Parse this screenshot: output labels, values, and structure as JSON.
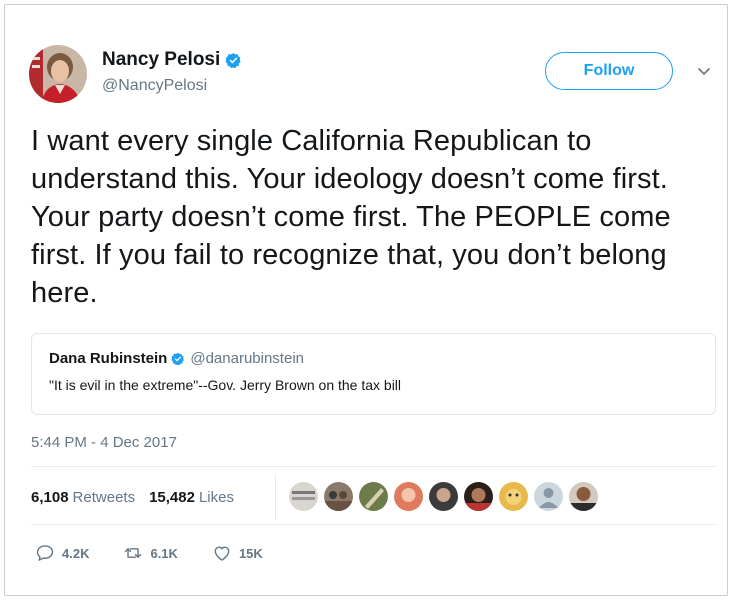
{
  "author": {
    "name": "Nancy Pelosi",
    "handle": "@NancyPelosi"
  },
  "follow_label": "Follow",
  "tweet_text": "I want every single California Republican to understand this. Your ideology doesn’t come first. Your party doesn’t come first. The PEOPLE come first. If you fail to recognize that, you don’t belong here.",
  "quoted": {
    "name": "Dana Rubinstein",
    "handle": "@danarubinstein",
    "text": "\"It is evil in the extreme\"--Gov. Jerry Brown on the tax bill"
  },
  "timestamp": "5:44 PM - 4 Dec 2017",
  "stats": {
    "retweets_count": "6,108",
    "retweets_label": "Retweets",
    "likes_count": "15,482",
    "likes_label": "Likes"
  },
  "actions": {
    "replies": "4.2K",
    "retweets": "6.1K",
    "likes": "15K"
  },
  "colors": {
    "accent": "#1da1f2",
    "muted": "#657786",
    "text": "#14171a"
  }
}
